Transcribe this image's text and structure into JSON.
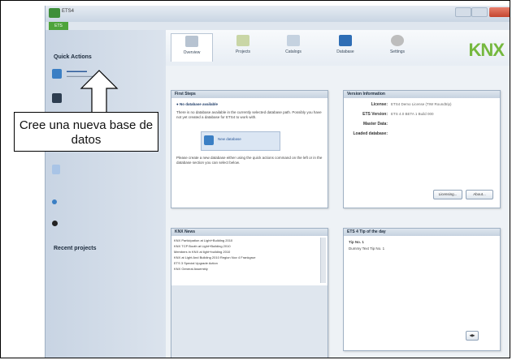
{
  "window": {
    "title": "ETS4",
    "tab": "ETS"
  },
  "sidebar": {
    "quick_actions_title": "Quick Actions",
    "recent_title": "Recent projects"
  },
  "ribbon": {
    "tabs": [
      {
        "label": "Overview",
        "icon": "overview-icon"
      },
      {
        "label": "Projects",
        "icon": "projects-icon"
      },
      {
        "label": "Catalogs",
        "icon": "catalogs-icon"
      },
      {
        "label": "Database",
        "icon": "database-icon"
      },
      {
        "label": "Settings",
        "icon": "settings-icon"
      }
    ],
    "logo": "KNX"
  },
  "panels": {
    "first_steps": {
      "title": "First Steps",
      "warning": "No database available",
      "body": "There is no database available in the currently selected database path. Possibly you have not yet created a database for ETS4 to work with.",
      "new_db_label": "New database",
      "footer": "Please create a new database either using the quick actions command on the left or in the database section you can select below."
    },
    "version_info": {
      "title": "Version Information",
      "rows": [
        {
          "label": "License:",
          "value": "ETS4 Demo License (TIW Roundtrip)"
        },
        {
          "label": "ETS Version:",
          "value": "ETS 4.0 BETA 1 Build 000"
        },
        {
          "label": "Master Data:",
          "value": ""
        },
        {
          "label": "Loaded database:",
          "value": ""
        }
      ],
      "licensing_btn": "Licensing...",
      "about_btn": "About..."
    },
    "knx_news": {
      "title": "KNX News",
      "items": [
        "KNX Participation at Light+Building 2010",
        "KNX TCP Booth at Light+Building 2010",
        "Members in KNX at light+building 2010",
        "KNX at Light And Building 2010 Region Nov 4 Frankgrue",
        "ETS 3 Special Upgrade Action",
        "KNX General Assembly"
      ]
    },
    "tip": {
      "title": "ETS 4 Tip of the day",
      "tip_no": "Tip No. 1",
      "tip_text": "Dummy Text Tip No. 1"
    }
  },
  "callout": {
    "text": "Cree una nueva base de datos"
  },
  "colors": {
    "knx_green": "#75b83e",
    "ets_green": "#4ea43b",
    "sidebar": "#c8d4e3"
  }
}
